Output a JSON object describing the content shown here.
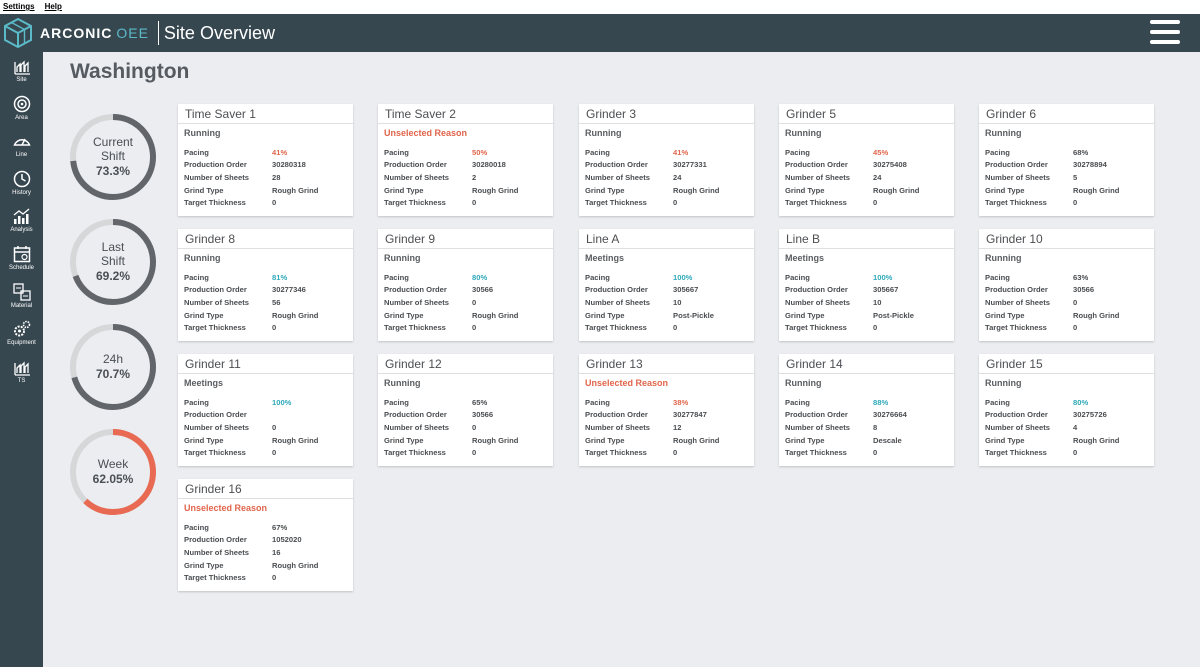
{
  "menu": {
    "settings": "Settings",
    "help": "Help"
  },
  "header": {
    "brand": "ARCONIC",
    "brand_suffix": "OEE",
    "title": "Site Overview"
  },
  "sidebar": [
    {
      "label": "Site",
      "icon": "site-icon"
    },
    {
      "label": "Area",
      "icon": "area-icon"
    },
    {
      "label": "Line",
      "icon": "line-gauge-icon"
    },
    {
      "label": "History",
      "icon": "history-icon"
    },
    {
      "label": "Analysis",
      "icon": "analysis-icon"
    },
    {
      "label": "Schedule",
      "icon": "schedule-icon"
    },
    {
      "label": "Material",
      "icon": "material-icon"
    },
    {
      "label": "Equipment",
      "icon": "equipment-icon"
    },
    {
      "label": "TS",
      "icon": "ts-icon"
    }
  ],
  "site": {
    "name": "Washington"
  },
  "colors": {
    "ring_gray": "#62666a",
    "ring_track": "#d6d7d9",
    "ring_red": "#e86a52",
    "warn": "#e0654b",
    "teal": "#2fa9b9"
  },
  "summary": [
    {
      "label_1": "Current",
      "label_2": "Shift",
      "value": "73.3%",
      "fraction": 0.733,
      "color": "gray"
    },
    {
      "label_1": "Last",
      "label_2": "Shift",
      "value": "69.2%",
      "fraction": 0.692,
      "color": "gray"
    },
    {
      "label_1": "24h",
      "label_2": "",
      "value": "70.7%",
      "fraction": 0.707,
      "color": "gray"
    },
    {
      "label_1": "Week",
      "label_2": "",
      "value": "62.05%",
      "fraction": 0.6205,
      "color": "red"
    }
  ],
  "labels": {
    "pacing": "Pacing",
    "production_order": "Production Order",
    "number_of_sheets": "Number of Sheets",
    "grind_type": "Grind Type",
    "target_thickness": "Target Thickness"
  },
  "machines": [
    {
      "name": "Time Saver 1",
      "status": "Running",
      "status_warn": false,
      "pacing": "41%",
      "pacing_color": "red",
      "production_order": "30280318",
      "number_of_sheets": "28",
      "grind_type": "Rough Grind",
      "target_thickness": "0"
    },
    {
      "name": "Time Saver 2",
      "status": "Unselected Reason",
      "status_warn": true,
      "pacing": "50%",
      "pacing_color": "red",
      "production_order": "30280018",
      "number_of_sheets": "2",
      "grind_type": "Rough Grind",
      "target_thickness": "0"
    },
    {
      "name": "Grinder 3",
      "status": "Running",
      "status_warn": false,
      "pacing": "41%",
      "pacing_color": "red",
      "production_order": "30277331",
      "number_of_sheets": "24",
      "grind_type": "Rough Grind",
      "target_thickness": "0"
    },
    {
      "name": "Grinder 5",
      "status": "Running",
      "status_warn": false,
      "pacing": "45%",
      "pacing_color": "red",
      "production_order": "30275408",
      "number_of_sheets": "24",
      "grind_type": "Rough Grind",
      "target_thickness": "0"
    },
    {
      "name": "Grinder 6",
      "status": "Running",
      "status_warn": false,
      "pacing": "68%",
      "pacing_color": "normal",
      "production_order": "30278894",
      "number_of_sheets": "5",
      "grind_type": "Rough Grind",
      "target_thickness": "0"
    },
    {
      "name": "Grinder 8",
      "status": "Running",
      "status_warn": false,
      "pacing": "81%",
      "pacing_color": "teal",
      "production_order": "30277346",
      "number_of_sheets": "56",
      "grind_type": "Rough Grind",
      "target_thickness": "0"
    },
    {
      "name": "Grinder 9",
      "status": "Running",
      "status_warn": false,
      "pacing": "80%",
      "pacing_color": "teal",
      "production_order": "30566",
      "number_of_sheets": "0",
      "grind_type": "Rough Grind",
      "target_thickness": "0"
    },
    {
      "name": "Line A",
      "status": "Meetings",
      "status_warn": false,
      "pacing": "100%",
      "pacing_color": "teal",
      "production_order": "305667",
      "number_of_sheets": "10",
      "grind_type": "Post-Pickle",
      "target_thickness": "0"
    },
    {
      "name": "Line B",
      "status": "Meetings",
      "status_warn": false,
      "pacing": "100%",
      "pacing_color": "teal",
      "production_order": "305667",
      "number_of_sheets": "10",
      "grind_type": "Post-Pickle",
      "target_thickness": "0"
    },
    {
      "name": "Grinder 10",
      "status": "Running",
      "status_warn": false,
      "pacing": "63%",
      "pacing_color": "normal",
      "production_order": "30566",
      "number_of_sheets": "0",
      "grind_type": "Rough Grind",
      "target_thickness": "0"
    },
    {
      "name": "Grinder 11",
      "status": "Meetings",
      "status_warn": false,
      "pacing": "100%",
      "pacing_color": "teal",
      "production_order": "",
      "number_of_sheets": "0",
      "grind_type": "Rough Grind",
      "target_thickness": "0"
    },
    {
      "name": "Grinder 12",
      "status": "Running",
      "status_warn": false,
      "pacing": "65%",
      "pacing_color": "normal",
      "production_order": "30566",
      "number_of_sheets": "0",
      "grind_type": "Rough Grind",
      "target_thickness": "0"
    },
    {
      "name": "Grinder 13",
      "status": "Unselected Reason",
      "status_warn": true,
      "pacing": "38%",
      "pacing_color": "red",
      "production_order": "30277847",
      "number_of_sheets": "12",
      "grind_type": "Rough Grind",
      "target_thickness": "0"
    },
    {
      "name": "Grinder 14",
      "status": "Running",
      "status_warn": false,
      "pacing": "88%",
      "pacing_color": "teal",
      "production_order": "30276664",
      "number_of_sheets": "8",
      "grind_type": "Descale",
      "target_thickness": "0"
    },
    {
      "name": "Grinder 15",
      "status": "Running",
      "status_warn": false,
      "pacing": "80%",
      "pacing_color": "teal",
      "production_order": "30275726",
      "number_of_sheets": "4",
      "grind_type": "Rough Grind",
      "target_thickness": "0"
    },
    {
      "name": "Grinder 16",
      "status": "Unselected Reason",
      "status_warn": true,
      "pacing": "67%",
      "pacing_color": "normal",
      "production_order": "1052020",
      "number_of_sheets": "16",
      "grind_type": "Rough Grind",
      "target_thickness": "0"
    }
  ]
}
